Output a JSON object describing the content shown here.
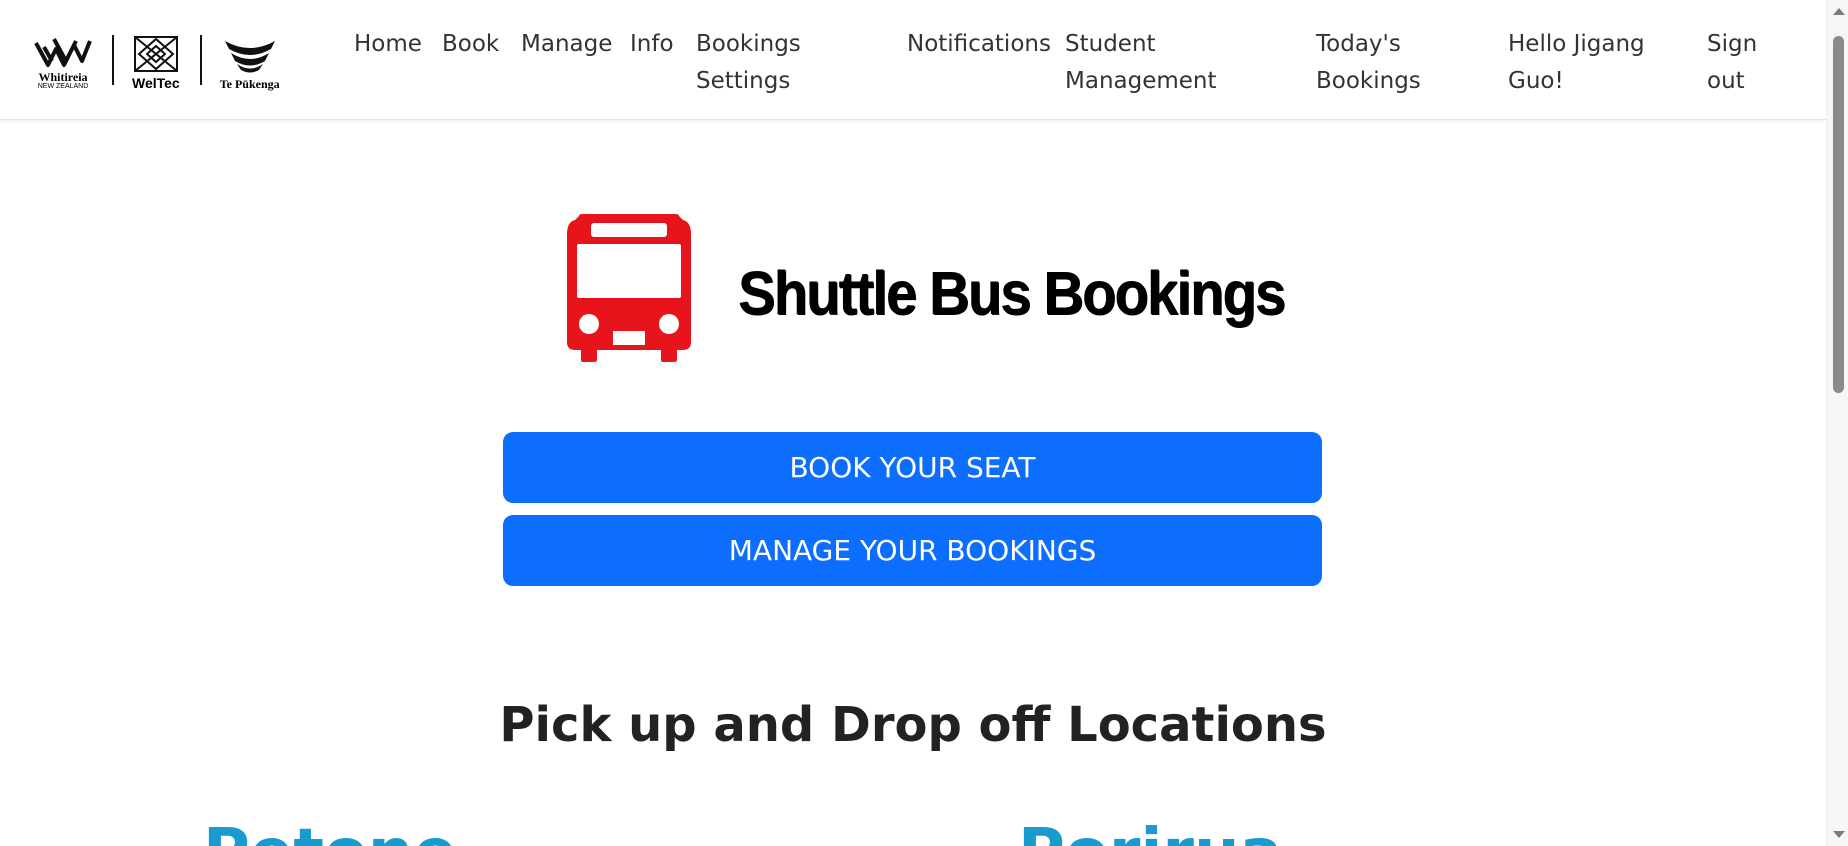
{
  "navbar": {
    "logos": [
      {
        "icon": "whitireia-logo",
        "text": "Whitireia",
        "subtext": "NEW ZEALAND"
      },
      {
        "icon": "weltec-logo",
        "text": "WelTec"
      },
      {
        "icon": "te-pukenga-logo",
        "text": "Te Pūkenga"
      }
    ],
    "links": [
      {
        "label": "Home"
      },
      {
        "label": "Book"
      },
      {
        "label": "Manage"
      },
      {
        "label": "Info"
      },
      {
        "label": "Bookings Settings"
      },
      {
        "label": "Notifications"
      },
      {
        "label": "Student Management"
      },
      {
        "label": "Today's Bookings"
      },
      {
        "label": "Hello Jigang Guo!"
      },
      {
        "label": "Sign out"
      }
    ]
  },
  "hero": {
    "icon": "bus-icon",
    "icon_color": "#e8141b",
    "title": "Shuttle Bus Bookings"
  },
  "actions": {
    "book_label": "BOOK YOUR SEAT",
    "manage_label": "MANAGE YOUR BOOKINGS",
    "button_color": "#0d6efd"
  },
  "locations": {
    "heading": "Pick up and Drop off Locations",
    "items": [
      {
        "name": "Petone"
      },
      {
        "name": "Porirua"
      }
    ],
    "name_color": "#1a9bd0"
  }
}
